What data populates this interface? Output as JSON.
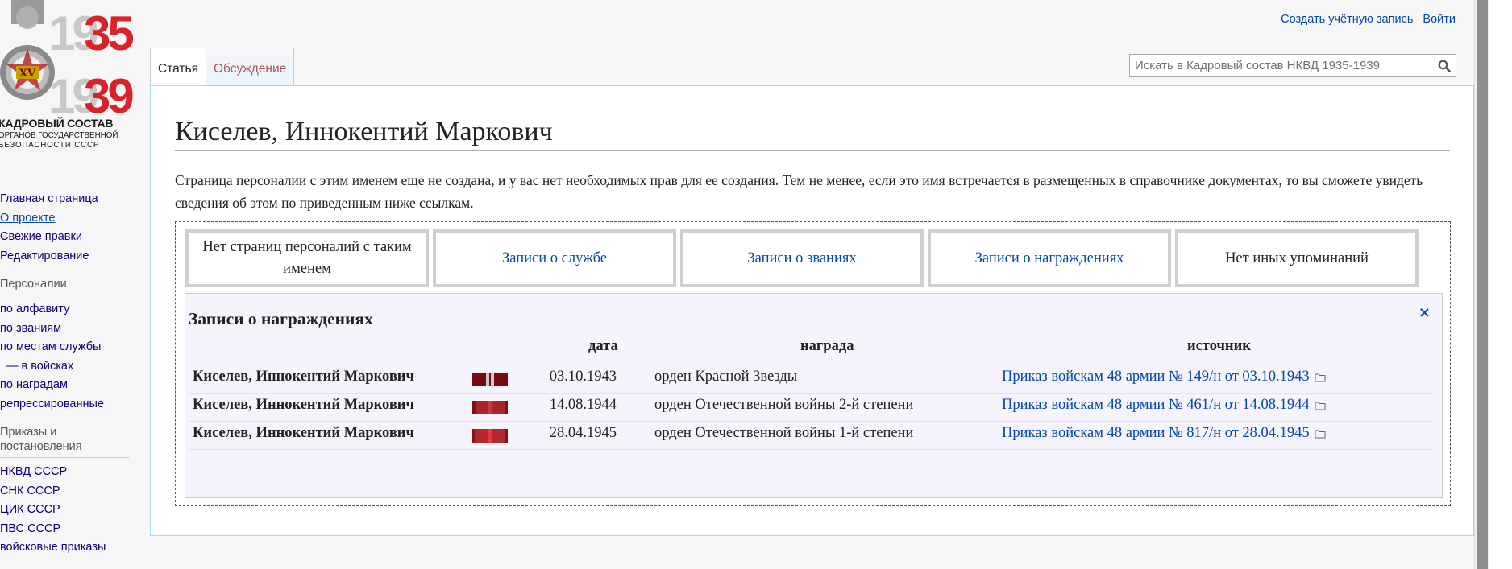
{
  "logo": {
    "years_top": "1935",
    "years_bottom": "1939",
    "badge_text": "XV",
    "line1": "КАДРОВЫЙ СОСТАВ",
    "line2": "ОРГАНОВ ГОСУДАРСТВЕННОЙ",
    "line3": "БЕЗОПАСНОСТИ СССР"
  },
  "sidebar": {
    "main": [
      {
        "label": "Главная страница"
      },
      {
        "label": "О проекте"
      },
      {
        "label": "Свежие правки"
      },
      {
        "label": "Редактирование"
      }
    ],
    "personalii_head": "Персоналии",
    "personalii": [
      {
        "label": "по алфавиту"
      },
      {
        "label": "по званиям"
      },
      {
        "label": "по местам службы"
      },
      {
        "label": "—  в войсках"
      },
      {
        "label": "по наградам"
      },
      {
        "label": "репрессированные"
      }
    ],
    "orders_head": "Приказы и постановления",
    "orders": [
      {
        "label": "НКВД СССР"
      },
      {
        "label": "СНК СССР"
      },
      {
        "label": "ЦИК СССР"
      },
      {
        "label": "ПВС СССР"
      },
      {
        "label": "войсковые приказы"
      }
    ]
  },
  "personal": {
    "create_account": "Создать учётную запись",
    "login": "Войти"
  },
  "tabs": {
    "article": "Статья",
    "discussion": "Обсуждение"
  },
  "search": {
    "placeholder": "Искать в Кадровый состав НКВД 1935-1939"
  },
  "page": {
    "title": "Киселев, Иннокентий Маркович",
    "intro": "Страница персоналии с этим именем еще не создана, и у вас нет необходимых прав для ее создания. Тем не менее, если это имя встречается в размещенных в справочнике документах, то вы сможете увидеть сведения об этом по приведенным ниже ссылкам."
  },
  "box_tabs": [
    {
      "label": "Нет страниц персоналий с таким именем"
    },
    {
      "label": "Записи о службе"
    },
    {
      "label": "Записи о званиях"
    },
    {
      "label": "Записи о награждениях"
    },
    {
      "label": "Нет иных упоминаний"
    }
  ],
  "awards_panel": {
    "title": "Записи о награждениях",
    "close": "×",
    "headers": {
      "date": "дата",
      "award": "награда",
      "source": "источник"
    },
    "rows": [
      {
        "name": "Киселев, Иннокентий Маркович",
        "date": "03.10.1943",
        "award": "орден Красной Звезды",
        "source": "Приказ войскам 48 армии № 149/н от 03.10.1943",
        "ribbon": "red-star"
      },
      {
        "name": "Киселев, Иннокентий Маркович",
        "date": "14.08.1944",
        "award": "орден Отечественной войны 2-й степени",
        "source": "Приказ войскам 48 армии № 461/н от 14.08.1944",
        "ribbon": "patriotic-war-2"
      },
      {
        "name": "Киселев, Иннокентий Маркович",
        "date": "28.04.1945",
        "award": "орден Отечественной войны 1-й степени",
        "source": "Приказ войскам 48 армии № 817/н от 28.04.1945",
        "ribbon": "patriotic-war-1"
      }
    ]
  },
  "colors": {
    "link": "#0645ad",
    "nav_link": "#0b0080",
    "panel_bg": "#f5f3fb",
    "logo_red": "#d8232a"
  }
}
